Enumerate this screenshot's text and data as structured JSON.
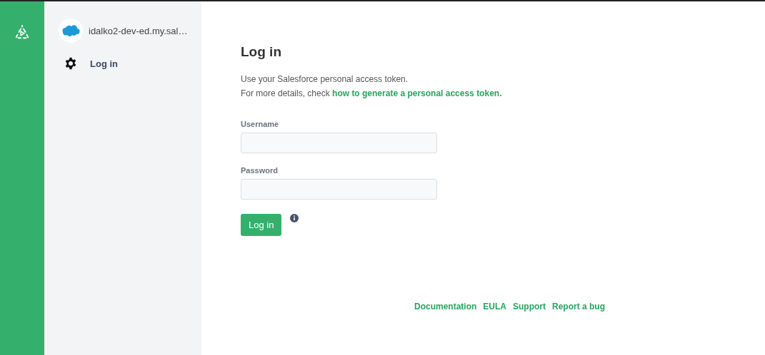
{
  "sidebar": {
    "account": "idalko2-dev-ed.my.sal…",
    "items": [
      {
        "label": "Log in",
        "selected": true
      }
    ]
  },
  "main": {
    "title": "Log in",
    "intro": "Use your Salesforce personal access token.",
    "details": "For more details, check",
    "details_link": "how to generate a personal access token.",
    "fields": [
      {
        "label": "Username"
      },
      {
        "label": "Password"
      }
    ],
    "button": "Log in"
  },
  "footer_links": [
    "Documentation",
    "EULA",
    "Support",
    "Report a bug"
  ]
}
